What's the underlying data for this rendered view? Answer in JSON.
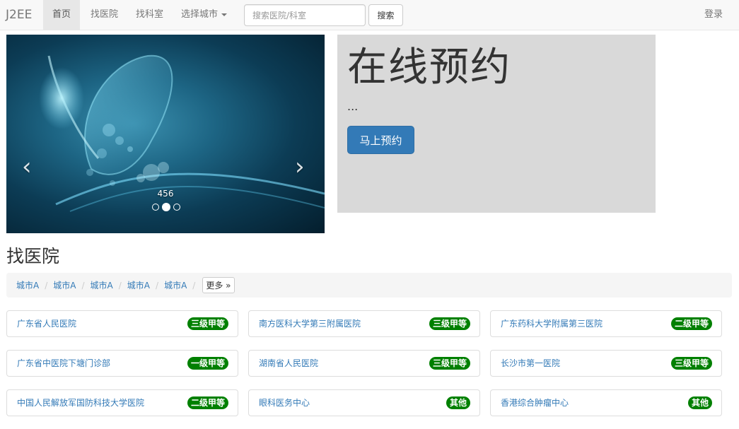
{
  "nav": {
    "brand": "J2EE",
    "home": "首页",
    "find_hospital": "找医院",
    "find_department": "找科室",
    "select_city": "选择城市",
    "search_placeholder": "搜索医院/科室",
    "search_button": "搜索",
    "login": "登录"
  },
  "carousel": {
    "caption": "456",
    "prev_glyph": "‹",
    "next_glyph": "›",
    "slide_count": 3,
    "active_index": 1
  },
  "jumbotron": {
    "title": "在线预约",
    "text": "...",
    "button": "马上预约"
  },
  "hospitals_section": {
    "title": "找医院",
    "cities": [
      "城市A",
      "城市A",
      "城市A",
      "城市A",
      "城市A"
    ],
    "more_label": "更多 »",
    "hospitals": [
      {
        "name": "广东省人民医院",
        "level": "三级甲等"
      },
      {
        "name": "南方医科大学第三附属医院",
        "level": "三级甲等"
      },
      {
        "name": "广东药科大学附属第三医院",
        "level": "二级甲等"
      },
      {
        "name": "广东省中医院下塘门诊部",
        "level": "一级甲等"
      },
      {
        "name": "湖南省人民医院",
        "level": "三级甲等"
      },
      {
        "name": "长沙市第一医院",
        "level": "三级甲等"
      },
      {
        "name": "中国人民解放军国防科技大学医院",
        "level": "二级甲等"
      },
      {
        "name": "眼科医务中心",
        "level": "其他"
      },
      {
        "name": "香港综合肿瘤中心",
        "level": "其他"
      }
    ]
  },
  "colors": {
    "primary": "#337ab7",
    "badge_green": "#008000",
    "jumbotron_bg": "#d9d9d9",
    "navbar_bg": "#f8f8f8"
  }
}
